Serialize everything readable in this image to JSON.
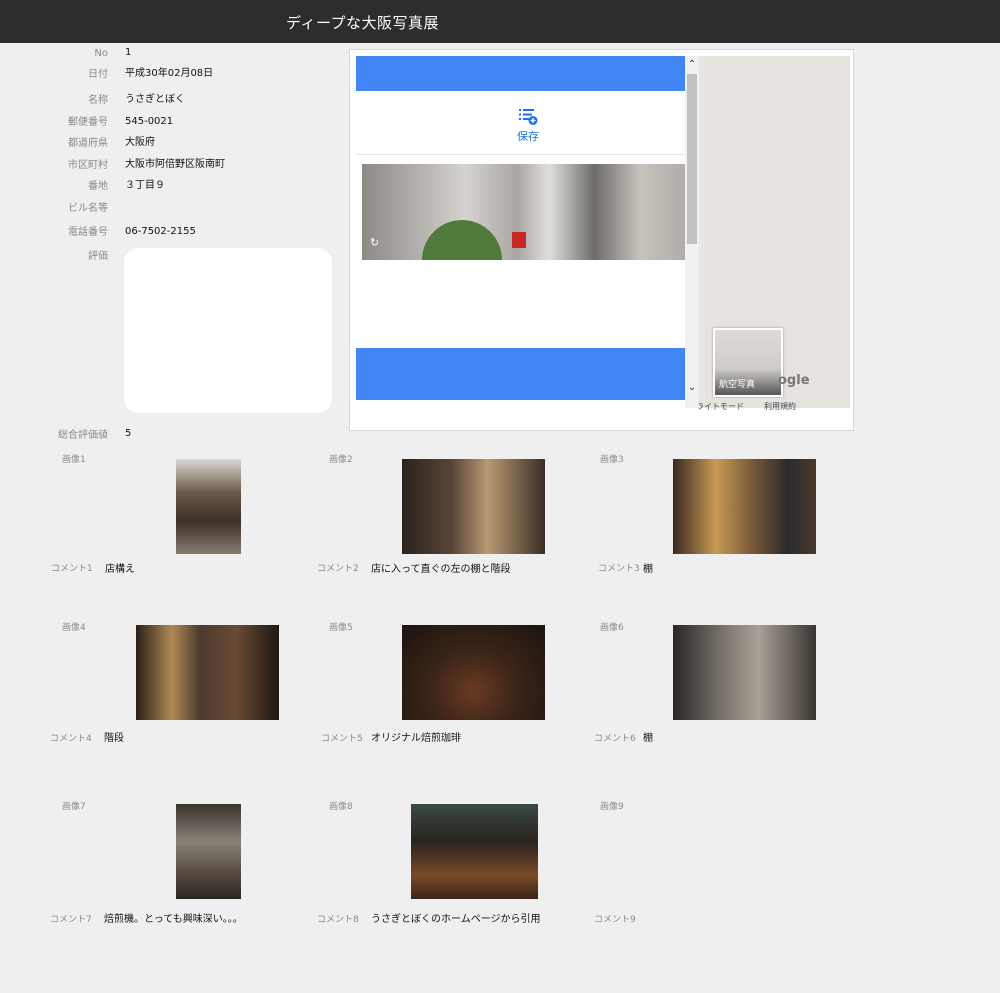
{
  "header": {
    "title": "ディープな大阪写真展"
  },
  "record": {
    "no": {
      "label": "No",
      "value": "1"
    },
    "date": {
      "label": "日付",
      "value": "平成30年02月08日"
    },
    "name": {
      "label": "名称",
      "value": "うさぎとぼく"
    },
    "zip": {
      "label": "郵便番号",
      "value": "545-0021"
    },
    "pref": {
      "label": "都道府県",
      "value": "大阪府"
    },
    "city": {
      "label": "市区町村",
      "value": "大阪市阿倍野区阪南町"
    },
    "addr": {
      "label": "番地",
      "value": "３丁目９"
    },
    "bldg": {
      "label": "ビル名等",
      "value": ""
    },
    "tel": {
      "label": "電話番号",
      "value": "06-7502-2155"
    },
    "rating": {
      "label": "評価",
      "value": ""
    },
    "total": {
      "label": "総合評価値",
      "value": "5"
    }
  },
  "map": {
    "save_label": "保存",
    "aerial_label": "航空写真",
    "google_text": "ogle",
    "footer_mode": "ライトモード",
    "footer_terms": "利用規約"
  },
  "gallery": [
    {
      "label": "画像1",
      "comment_label": "コメント1",
      "comment": "店構え"
    },
    {
      "label": "画像2",
      "comment_label": "コメント2",
      "comment": "店に入って直ぐの左の棚と階段"
    },
    {
      "label": "画像3",
      "comment_label": "コメント3",
      "comment": "棚"
    },
    {
      "label": "画像4",
      "comment_label": "コメント4",
      "comment": "階段"
    },
    {
      "label": "画像5",
      "comment_label": "コメント5",
      "comment": "オリジナル焙煎珈琲"
    },
    {
      "label": "画像6",
      "comment_label": "コメント6",
      "comment": "棚"
    },
    {
      "label": "画像7",
      "comment_label": "コメント7",
      "comment": "焙煎機。とっても興味深い。。。"
    },
    {
      "label": "画像8",
      "comment_label": "コメント8",
      "comment": "うさぎとぼくのホームページから引用"
    },
    {
      "label": "画像9",
      "comment_label": "コメント9",
      "comment": ""
    }
  ]
}
